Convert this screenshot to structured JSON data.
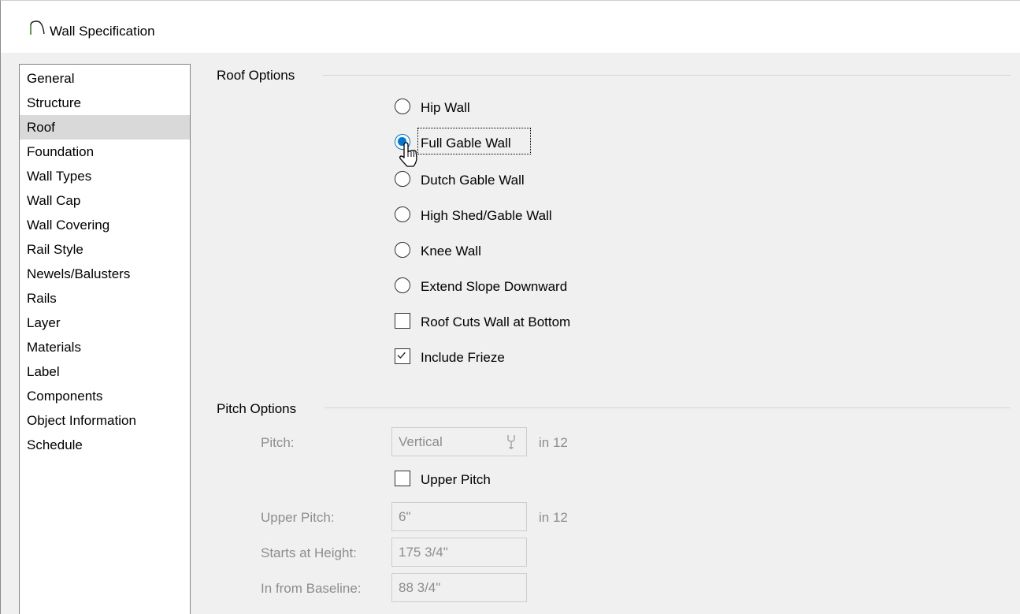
{
  "window": {
    "title": "Wall Specification",
    "title_icon": "arch-icon"
  },
  "sidebar": {
    "items": [
      {
        "label": "General",
        "selected": false
      },
      {
        "label": "Structure",
        "selected": false
      },
      {
        "label": "Roof",
        "selected": true
      },
      {
        "label": "Foundation",
        "selected": false
      },
      {
        "label": "Wall Types",
        "selected": false
      },
      {
        "label": "Wall Cap",
        "selected": false
      },
      {
        "label": "Wall Covering",
        "selected": false
      },
      {
        "label": "Rail Style",
        "selected": false
      },
      {
        "label": "Newels/Balusters",
        "selected": false
      },
      {
        "label": "Rails",
        "selected": false
      },
      {
        "label": "Layer",
        "selected": false
      },
      {
        "label": "Materials",
        "selected": false
      },
      {
        "label": "Label",
        "selected": false
      },
      {
        "label": "Components",
        "selected": false
      },
      {
        "label": "Object Information",
        "selected": false
      },
      {
        "label": "Schedule",
        "selected": false
      }
    ]
  },
  "roof_options": {
    "heading": "Roof Options",
    "radios": [
      {
        "label": "Hip Wall",
        "checked": false
      },
      {
        "label": "Full Gable Wall",
        "checked": true
      },
      {
        "label": "Dutch Gable Wall",
        "checked": false
      },
      {
        "label": "High Shed/Gable Wall",
        "checked": false
      },
      {
        "label": "Knee Wall",
        "checked": false
      },
      {
        "label": "Extend Slope Downward",
        "checked": false
      }
    ],
    "roof_cuts_wall": {
      "label": "Roof Cuts Wall at Bottom",
      "checked": false
    },
    "include_frieze": {
      "label": "Include Frieze",
      "checked": true
    }
  },
  "pitch_options": {
    "heading": "Pitch Options",
    "pitch": {
      "label": "Pitch:",
      "value": "Vertical",
      "unit": "in 12",
      "icon": "wrench-icon"
    },
    "upper_pitch_check": {
      "label": "Upper Pitch",
      "checked": false
    },
    "upper_pitch": {
      "label": "Upper Pitch:",
      "value": "6\"",
      "unit": "in 12"
    },
    "starts_at_height": {
      "label": "Starts at Height:",
      "value": "175 3/4\""
    },
    "in_from_baseline": {
      "label": "In from Baseline:",
      "value": "88 3/4\""
    }
  },
  "colors": {
    "accent": "#0078d7",
    "disabled_text": "#8d8d8d",
    "selection": "#d9d9d9"
  }
}
